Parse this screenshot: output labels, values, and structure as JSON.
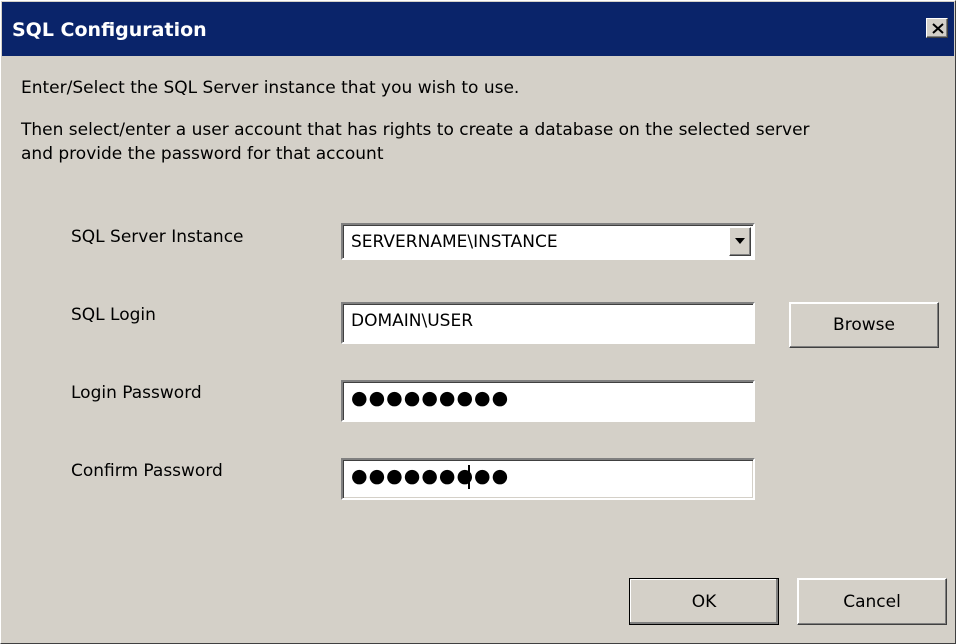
{
  "window": {
    "title": "SQL Configuration"
  },
  "instructions": {
    "line1": "Enter/Select the SQL Server instance that you wish to use.",
    "line2": "Then select/enter a user account that has rights to create a database on the selected server",
    "line3": "and provide the password for that account"
  },
  "form": {
    "instance_label": "SQL Server Instance",
    "instance_value": "SERVERNAME\\INSTANCE",
    "login_label": "SQL Login",
    "login_value": "DOMAIN\\USER",
    "password_label": "Login Password",
    "password_value": "●●●●●●●●●",
    "confirm_label": "Confirm Password",
    "confirm_value": "●●●●●●●●●"
  },
  "buttons": {
    "browse": "Browse",
    "ok": "OK",
    "cancel": "Cancel"
  },
  "icons": {
    "close": "close-icon",
    "dropdown": "chevron-down-icon"
  },
  "colors": {
    "titlebar": "#0a246a",
    "dialog_face": "#d4d0c8"
  }
}
